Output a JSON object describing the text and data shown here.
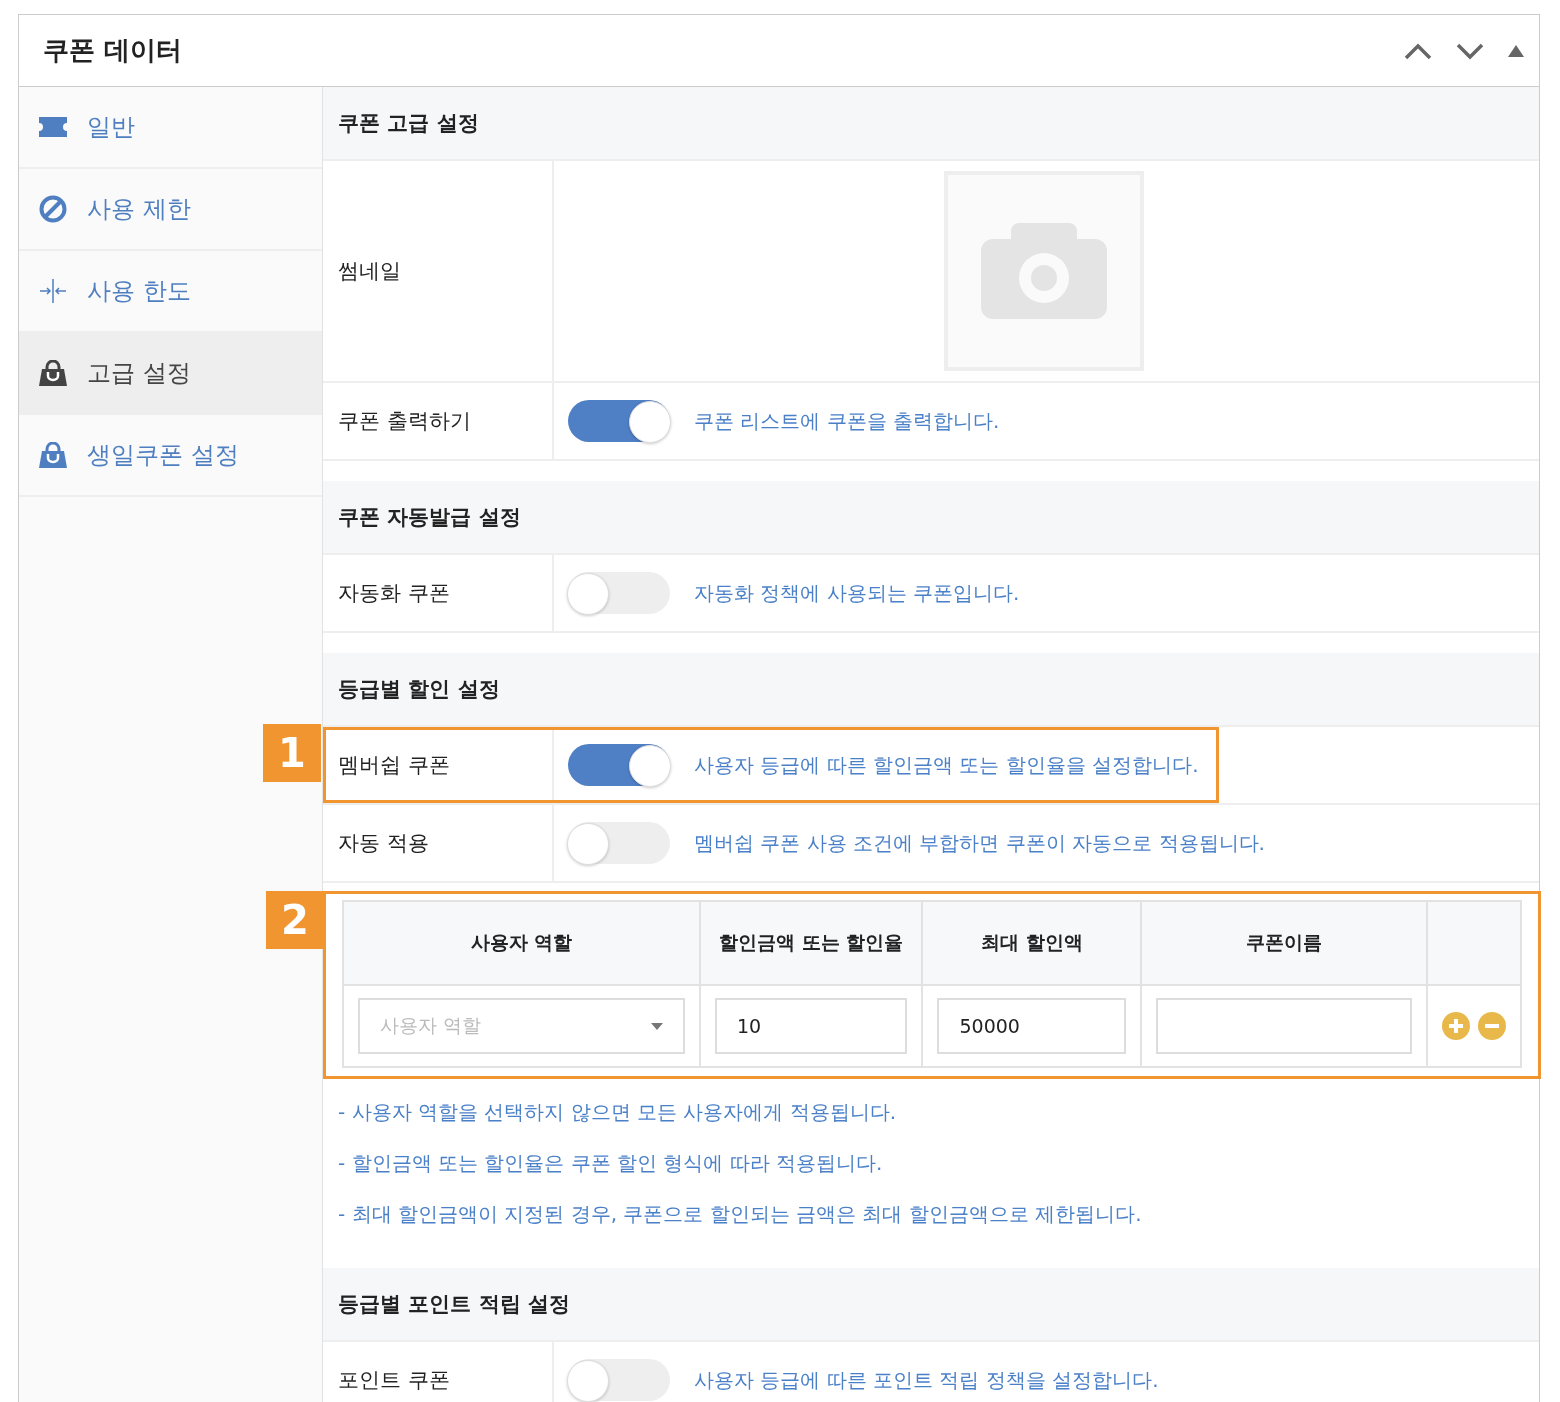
{
  "panel": {
    "title": "쿠폰 데이터"
  },
  "sidebar": {
    "items": [
      {
        "label": "일반",
        "kind": "ticket",
        "selected": false
      },
      {
        "label": "사용 제한",
        "kind": "ban",
        "selected": false
      },
      {
        "label": "사용 한도",
        "kind": "limit",
        "selected": false
      },
      {
        "label": "고급 설정",
        "kind": "bag",
        "selected": true
      },
      {
        "label": "생일쿠폰 설정",
        "kind": "bag",
        "selected": false
      }
    ]
  },
  "sections": [
    {
      "title": "쿠폰 고급 설정",
      "rows": [
        {
          "kind": "image",
          "label": "썸네일"
        },
        {
          "kind": "toggle",
          "label": "쿠폰 출력하기",
          "on": true,
          "description": "쿠폰 리스트에 쿠폰을 출력합니다."
        }
      ]
    },
    {
      "title": "쿠폰 자동발급 설정",
      "rows": [
        {
          "kind": "toggle",
          "label": "자동화 쿠폰",
          "on": false,
          "description": "자동화 정책에 사용되는 쿠폰입니다."
        }
      ]
    },
    {
      "title": "등급별 할인 설정",
      "rows": [
        {
          "kind": "toggle",
          "label": "멤버쉽 쿠폰",
          "on": true,
          "description": "사용자 등급에 따른 할인금액 또는 할인율을 설정합니다.",
          "callout": "1"
        },
        {
          "kind": "toggle",
          "label": "자동 적용",
          "on": false,
          "description": "멤버쉽 쿠폰 사용 조건에 부합하면 쿠폰이 자동으로 적용됩니다."
        }
      ],
      "table": {
        "callout": "2",
        "columns": [
          "사용자 역할",
          "할인금액 또는 할인율",
          "최대 할인액",
          "쿠폰이름"
        ],
        "rows": [
          {
            "role": {
              "placeholder": "사용자 역할"
            },
            "amount": "10",
            "max": "50000"
          }
        ]
      },
      "notes": [
        "- 사용자 역할을 선택하지 않으면 모든 사용자에게 적용됩니다.",
        "- 할인금액 또는 할인율은 쿠폰 할인 형식에 따라 적용됩니다.",
        "- 최대 할인금액이 지정된 경우, 쿠폰으로 할인되는 금액은 최대 할인금액으로 제한됩니다."
      ]
    },
    {
      "title": "등급별 포인트 적립 설정",
      "rows": [
        {
          "kind": "toggle",
          "label": "포인트 쿠폰",
          "on": false,
          "description": "사용자 등급에 따른 포인트 적립 정책을 설정합니다."
        }
      ]
    }
  ]
}
